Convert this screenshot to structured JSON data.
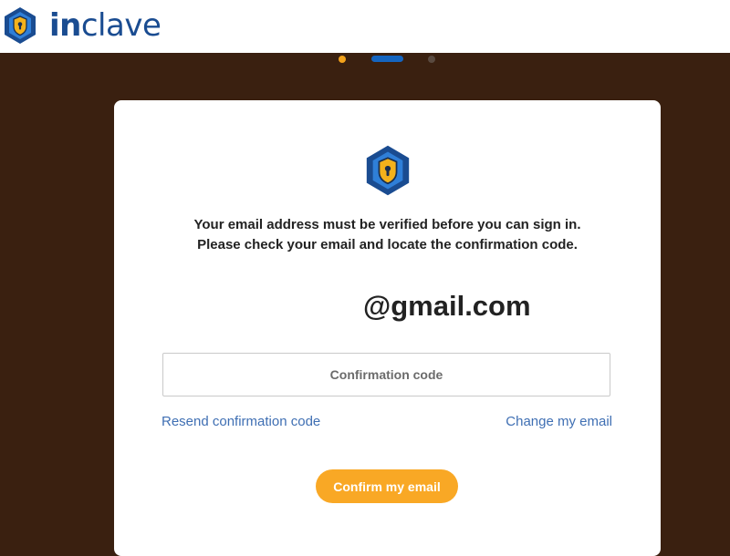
{
  "brand": {
    "name_prefix": "in",
    "name_suffix": "clave",
    "logo_icon": "shield-lock-icon"
  },
  "steps": {
    "total": 3,
    "current": 2,
    "colors": [
      "#f3a21b",
      "#1565c0",
      "#5a4a40"
    ]
  },
  "card": {
    "icon": "shield-lock-icon",
    "message_line1": "Your email address must be verified before you can sign in.",
    "message_line2": "Please check your email and locate the confirmation code.",
    "email": "@gmail.com",
    "code_placeholder": "Confirmation code",
    "resend_label": "Resend confirmation code",
    "change_label": "Change my email",
    "confirm_label": "Confirm my email"
  },
  "colors": {
    "background": "#3a2010",
    "accent": "#f9a825",
    "brand_blue": "#1a4c91",
    "link": "#3f6fb3"
  }
}
